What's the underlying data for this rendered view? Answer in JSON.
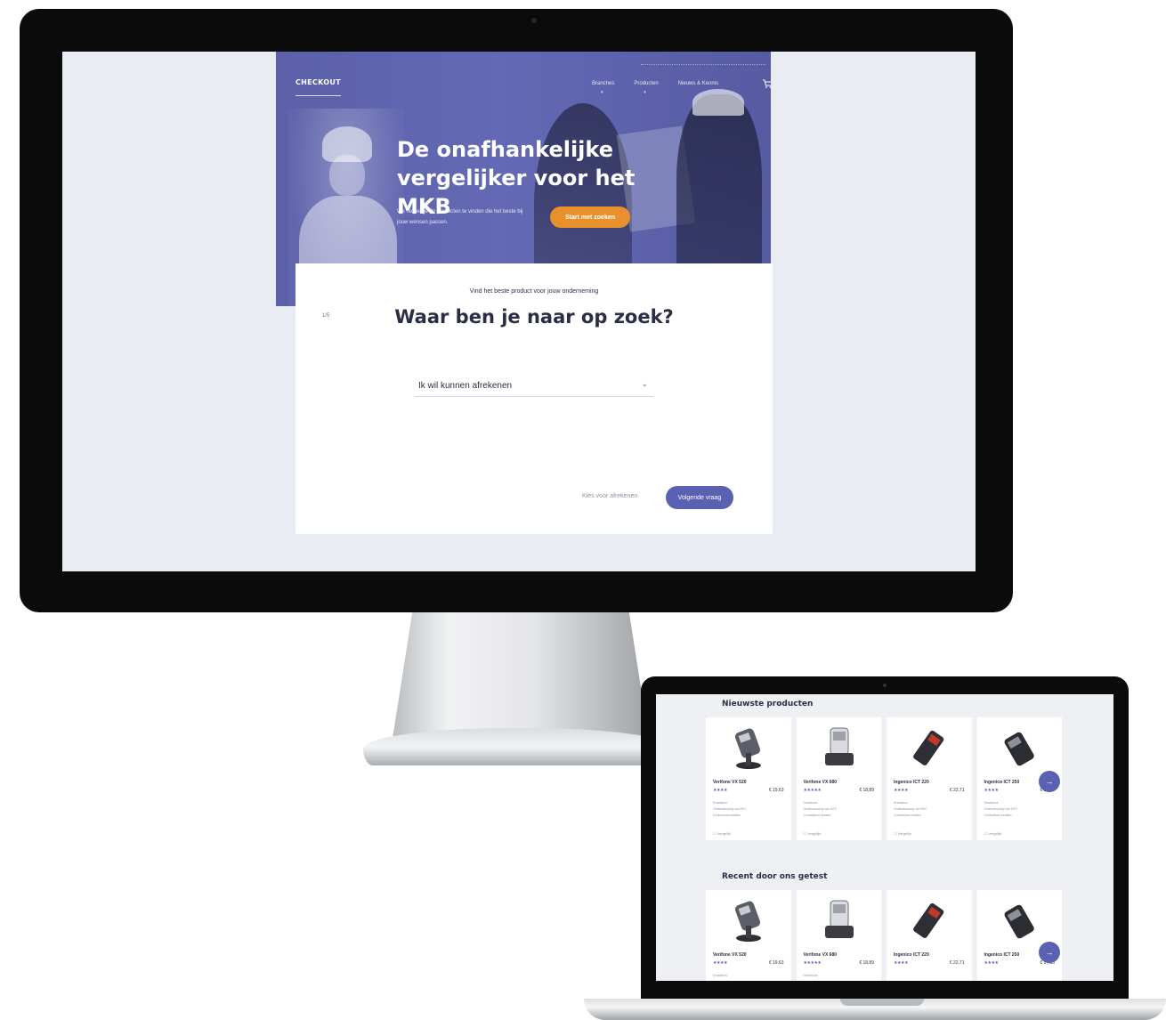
{
  "desktop": {
    "logo": "CHECKOUT",
    "nav": [
      "Branches",
      "Producten",
      "Nieuws & Kennis"
    ],
    "hero": {
      "title": "De onafhankelijke vergelijker voor het MKB",
      "subtitle": "We helpen je de producten te vinden die het beste bij jouw wensen passen.",
      "cta": "Start met zoeken"
    },
    "card": {
      "step": "1/5",
      "kicker": "Vind het beste product voor jouw onderneming",
      "question": "Waar ben je naar op zoek?",
      "select_value": "Ik wil kunnen afrekenen",
      "skip_link": "Kies voor afrekenen",
      "next_button": "Volgende vraag"
    }
  },
  "laptop": {
    "sections": [
      {
        "title": "Nieuwste producten",
        "products": [
          {
            "name": "Verifone VX 520",
            "stars": "★★★★",
            "price": "€ 19,63",
            "features": [
              "Draadloos",
              "Ondersteuning van NFC",
              "Contactloos betalen"
            ],
            "compare": "Vergelijk"
          },
          {
            "name": "Verifone VX 680",
            "stars": "★★★★★",
            "price": "€ 18,89",
            "features": [
              "Draadloos",
              "Ondersteuning van NFC",
              "Contactloos betalen"
            ],
            "compare": "Vergelijk"
          },
          {
            "name": "Ingenico ICT 220",
            "stars": "★★★★",
            "price": "€ 22,71",
            "features": [
              "Draadloos",
              "Ondersteuning van NFC",
              "Contactloos betalen"
            ],
            "compare": "Vergelijk"
          },
          {
            "name": "Ingenico ICT 250",
            "stars": "★★★★",
            "price": "€ 17,35",
            "features": [
              "Draadloos",
              "Ondersteuning van NFC",
              "Contactloos betalen"
            ],
            "compare": "Vergelijk"
          }
        ]
      },
      {
        "title": "Recent door ons getest",
        "products": [
          {
            "name": "Verifone VX 520",
            "stars": "★★★★",
            "price": "€ 19,63",
            "features": [
              "Draadloos"
            ],
            "compare": ""
          },
          {
            "name": "Verifone VX 680",
            "stars": "★★★★★",
            "price": "€ 18,89",
            "features": [
              "Draadloos"
            ],
            "compare": ""
          },
          {
            "name": "Ingenico ICT 220",
            "stars": "★★★★",
            "price": "€ 22,71",
            "features": [],
            "compare": ""
          },
          {
            "name": "Ingenico ICT 250",
            "stars": "★★★★",
            "price": "€ 17,35",
            "features": [],
            "compare": ""
          }
        ]
      }
    ],
    "fab_icon": "arrow-right-icon"
  },
  "colors": {
    "brand": "#5a61b2",
    "accent": "#e8912c",
    "text": "#2b2d45"
  }
}
